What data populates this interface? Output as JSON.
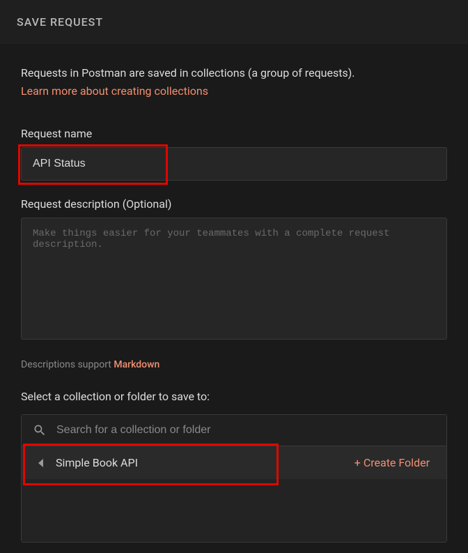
{
  "header": {
    "title": "SAVE REQUEST"
  },
  "intro": {
    "text": "Requests in Postman are saved in collections (a group of requests).",
    "link": "Learn more about creating collections"
  },
  "requestName": {
    "label": "Request name",
    "value": "API Status"
  },
  "requestDescription": {
    "label": "Request description (Optional)",
    "placeholder": "Make things easier for your teammates with a complete request description."
  },
  "descSupport": {
    "text": "Descriptions support ",
    "link": "Markdown"
  },
  "selectCollection": {
    "label": "Select a collection or folder to save to:",
    "searchPlaceholder": "Search for a collection or folder",
    "collectionName": "Simple Book API",
    "createFolder": "+ Create Folder"
  }
}
